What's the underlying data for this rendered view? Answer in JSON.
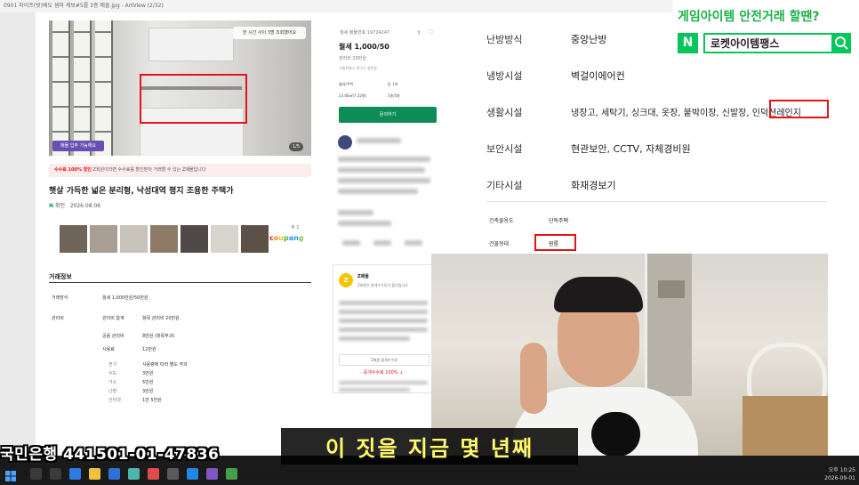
{
  "window": {
    "title": "0901 파이프(빗)베도 셈마 제보#5를 3층 매물.jpg - ArtView (2/32)"
  },
  "listing": {
    "save_badge": "한 시간 사이 3명 조회했어요",
    "photo_tag": "매물 입주 가능해요",
    "photo_count": "1/5",
    "promo_label": "수수료 100% 할인",
    "promo_text": "Z회원이라면 수수료를 할인받아 거래할 수 있는 Z매물입니다",
    "title": "햇살 가득한 넓은 분리형, 낙성대역 평지 조용한 주택가",
    "confirm_mark": "N",
    "confirm_label": "확인",
    "confirm_date": "2026.08.06",
    "coupang_top": "쿠 1",
    "coupang": "coupang",
    "info_title": "거래정보",
    "info_rows": [
      {
        "label": "거래방식",
        "value": "월세 1,000만원/50만원"
      },
      {
        "label": "관리비",
        "value": "관리비 합계",
        "extra": "항목 관리비 20만원"
      },
      {
        "label": "",
        "value": "공용 관리비",
        "extra": "8만원 (항목부과)"
      },
      {
        "label": "",
        "value": "사용료",
        "extra": "12만원"
      },
      {
        "label": "",
        "value": "전기",
        "extra": "사용량에 따라 별도 부과"
      },
      {
        "label": "",
        "value": "수도",
        "extra": "3만원"
      },
      {
        "label": "",
        "value": "가스",
        "extra": "5만원"
      },
      {
        "label": "",
        "value": "난방",
        "extra": "3만원"
      },
      {
        "label": "",
        "value": "인터넷",
        "extra": "1만 5천원"
      }
    ]
  },
  "mid": {
    "deal_tag": "월세  매물번호 19724247",
    "price": "월세 1,000/50",
    "mgmt": "관리비 20만원",
    "addr": "서울특별시 관악구 봉천동",
    "specs": [
      "월세/주택",
      "방 1개",
      "23.68㎡(7.22평)",
      "5층/5층"
    ],
    "contact": "문의하기",
    "z_name": "Z매물",
    "z_desc": "Z회원은 중개수수료가 할인됩니다",
    "z_btn": "Z회원 중개수수료",
    "z_fee": "중개수수료 100% ↓"
  },
  "detail": {
    "rows": [
      {
        "key": "난방방식",
        "value": "중앙난방"
      },
      {
        "key": "냉방시설",
        "value": "벽걸이에어컨"
      },
      {
        "key": "생활시설",
        "value": "냉장고, 세탁기, 싱크대, 옷장, 붙박이장, 신발장, 인덕션레인지"
      },
      {
        "key": "보안시설",
        "value": "현관보안, CCTV, 자체경비원"
      },
      {
        "key": "기타시설",
        "value": "화재경보기"
      }
    ],
    "small_rows": [
      {
        "key": "건축물용도",
        "value": "단독주택"
      },
      {
        "key": "건물형태",
        "value": "원룸"
      }
    ]
  },
  "ad": {
    "headline": "게임아이템 안전거래 할땐?",
    "n_logo": "N",
    "search_text": "로켓아이템팽스"
  },
  "overlay": {
    "account": "국민은행 441501-01-47836",
    "subtitle": "이 짓을 지금 몇 년째"
  },
  "clock": {
    "time": "오후 10:25",
    "date": "2026-09-01"
  }
}
